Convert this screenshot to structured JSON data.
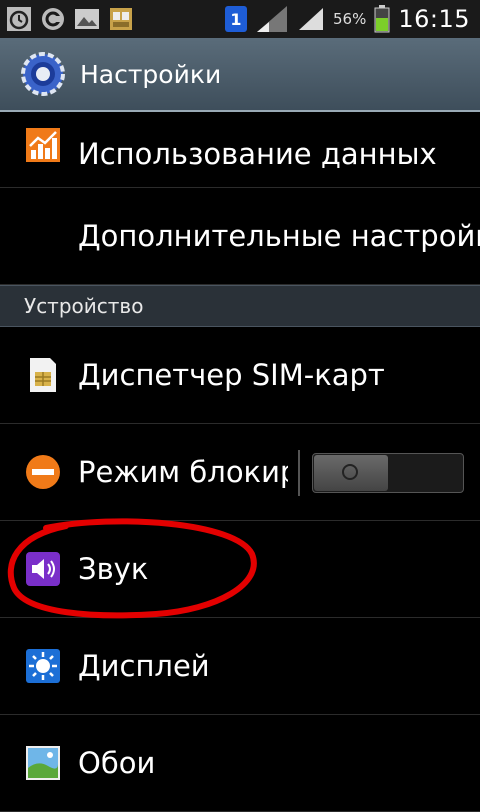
{
  "status_bar": {
    "sim_number": "1",
    "battery_percent": "56%",
    "time": "16:15",
    "icons": [
      "alarm-icon",
      "sync-icon",
      "gallery-icon",
      "sim-icon",
      "signal-icon",
      "battery-icon"
    ]
  },
  "action_bar": {
    "title": "Настройки",
    "icon": "settings-gear-icon"
  },
  "list": {
    "data_usage": {
      "label": "Использование данных",
      "icon": "data-usage-icon"
    },
    "more_settings": {
      "label": "Дополнительные настройки"
    },
    "section_device": {
      "label": "Устройство"
    },
    "sim_manager": {
      "label": "Диспетчер SIM-карт",
      "icon": "sim-card-icon"
    },
    "blocking_mode": {
      "label": "Режим блокировки",
      "icon": "blocking-icon",
      "toggle_on": false
    },
    "sound": {
      "label": "Звук",
      "icon": "speaker-icon"
    },
    "display": {
      "label": "Дисплей",
      "icon": "display-icon"
    },
    "wallpaper": {
      "label": "Обои",
      "icon": "wallpaper-icon"
    }
  },
  "colors": {
    "annotation": "#e30000",
    "action_bar": "#4d5d6a",
    "section_header": "#2a3138"
  }
}
